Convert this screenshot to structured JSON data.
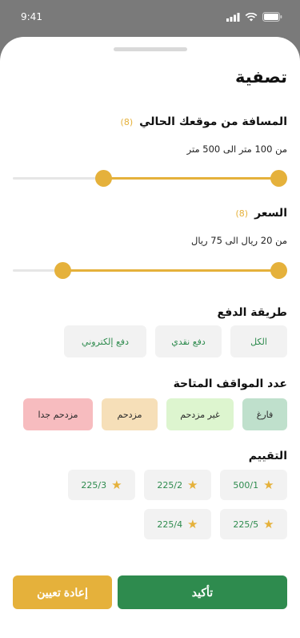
{
  "status": {
    "time": "9:41"
  },
  "title": "تصفية",
  "distance": {
    "title": "المسافة من موقعك الحالي",
    "count": "(8)",
    "range_text": "من 100 متر الى 500 متر",
    "min_fraction": 0.0,
    "low": 0.32,
    "high": 1.0
  },
  "price": {
    "title": "السعر",
    "count": "(8)",
    "range_text": "من 20 ريال الى 75 ريال",
    "low": 0.16,
    "high": 1.0
  },
  "payment": {
    "title": "طريقة الدفع",
    "options": [
      "الكل",
      "دفع نقدي",
      "دفع إلكتروني"
    ]
  },
  "parking": {
    "title": "عدد المواقف المتاحة",
    "options": [
      "فارغ",
      "غير مزدحم",
      "مزدحم",
      "مزدحم جدا"
    ],
    "colors": [
      "#bfe0cc",
      "#ddf5cf",
      "#f6dfb8",
      "#f7bcbf"
    ]
  },
  "rating": {
    "title": "التقييم",
    "options": [
      "500/1",
      "225/2",
      "225/3",
      "225/5",
      "225/4"
    ]
  },
  "buttons": {
    "confirm": "تأكيد",
    "reset": "إعادة تعيين"
  }
}
